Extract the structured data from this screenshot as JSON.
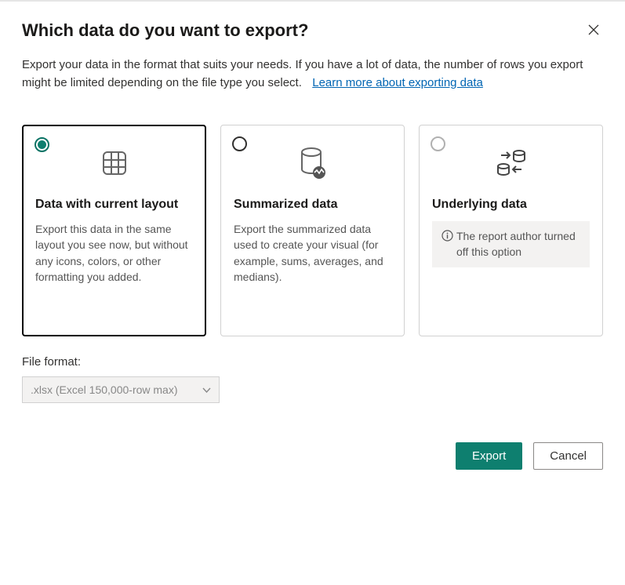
{
  "dialog": {
    "title": "Which data do you want to export?",
    "description": "Export your data in the format that suits your needs. If you have a lot of data, the number of rows you export might be limited depending on the file type you select.",
    "learn_more": "Learn more about exporting data"
  },
  "options": [
    {
      "title": "Data with current layout",
      "description": "Export this data in the same layout you see now, but without any icons, colors, or other formatting you added.",
      "selected": true
    },
    {
      "title": "Summarized data",
      "description": "Export the summarized data used to create your visual (for example, sums, averages, and medians).",
      "selected": false
    },
    {
      "title": "Underlying data",
      "disabled_msg": "The report author turned off this option",
      "selected": false,
      "disabled": true
    }
  ],
  "file_format": {
    "label": "File format:",
    "selected": ".xlsx (Excel 150,000-row max)"
  },
  "buttons": {
    "export": "Export",
    "cancel": "Cancel"
  }
}
